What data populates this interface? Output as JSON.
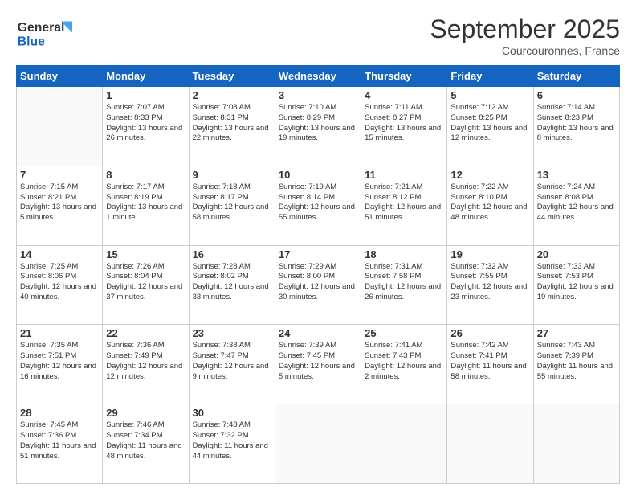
{
  "header": {
    "logo_line1": "General",
    "logo_line2": "Blue",
    "month": "September 2025",
    "location": "Courcouronnes, France"
  },
  "weekdays": [
    "Sunday",
    "Monday",
    "Tuesday",
    "Wednesday",
    "Thursday",
    "Friday",
    "Saturday"
  ],
  "weeks": [
    [
      {
        "day": "",
        "info": ""
      },
      {
        "day": "1",
        "info": "Sunrise: 7:07 AM\nSunset: 8:33 PM\nDaylight: 13 hours\nand 26 minutes."
      },
      {
        "day": "2",
        "info": "Sunrise: 7:08 AM\nSunset: 8:31 PM\nDaylight: 13 hours\nand 22 minutes."
      },
      {
        "day": "3",
        "info": "Sunrise: 7:10 AM\nSunset: 8:29 PM\nDaylight: 13 hours\nand 19 minutes."
      },
      {
        "day": "4",
        "info": "Sunrise: 7:11 AM\nSunset: 8:27 PM\nDaylight: 13 hours\nand 15 minutes."
      },
      {
        "day": "5",
        "info": "Sunrise: 7:12 AM\nSunset: 8:25 PM\nDaylight: 13 hours\nand 12 minutes."
      },
      {
        "day": "6",
        "info": "Sunrise: 7:14 AM\nSunset: 8:23 PM\nDaylight: 13 hours\nand 8 minutes."
      }
    ],
    [
      {
        "day": "7",
        "info": "Sunrise: 7:15 AM\nSunset: 8:21 PM\nDaylight: 13 hours\nand 5 minutes."
      },
      {
        "day": "8",
        "info": "Sunrise: 7:17 AM\nSunset: 8:19 PM\nDaylight: 13 hours\nand 1 minute."
      },
      {
        "day": "9",
        "info": "Sunrise: 7:18 AM\nSunset: 8:17 PM\nDaylight: 12 hours\nand 58 minutes."
      },
      {
        "day": "10",
        "info": "Sunrise: 7:19 AM\nSunset: 8:14 PM\nDaylight: 12 hours\nand 55 minutes."
      },
      {
        "day": "11",
        "info": "Sunrise: 7:21 AM\nSunset: 8:12 PM\nDaylight: 12 hours\nand 51 minutes."
      },
      {
        "day": "12",
        "info": "Sunrise: 7:22 AM\nSunset: 8:10 PM\nDaylight: 12 hours\nand 48 minutes."
      },
      {
        "day": "13",
        "info": "Sunrise: 7:24 AM\nSunset: 8:08 PM\nDaylight: 12 hours\nand 44 minutes."
      }
    ],
    [
      {
        "day": "14",
        "info": "Sunrise: 7:25 AM\nSunset: 8:06 PM\nDaylight: 12 hours\nand 40 minutes."
      },
      {
        "day": "15",
        "info": "Sunrise: 7:26 AM\nSunset: 8:04 PM\nDaylight: 12 hours\nand 37 minutes."
      },
      {
        "day": "16",
        "info": "Sunrise: 7:28 AM\nSunset: 8:02 PM\nDaylight: 12 hours\nand 33 minutes."
      },
      {
        "day": "17",
        "info": "Sunrise: 7:29 AM\nSunset: 8:00 PM\nDaylight: 12 hours\nand 30 minutes."
      },
      {
        "day": "18",
        "info": "Sunrise: 7:31 AM\nSunset: 7:58 PM\nDaylight: 12 hours\nand 26 minutes."
      },
      {
        "day": "19",
        "info": "Sunrise: 7:32 AM\nSunset: 7:55 PM\nDaylight: 12 hours\nand 23 minutes."
      },
      {
        "day": "20",
        "info": "Sunrise: 7:33 AM\nSunset: 7:53 PM\nDaylight: 12 hours\nand 19 minutes."
      }
    ],
    [
      {
        "day": "21",
        "info": "Sunrise: 7:35 AM\nSunset: 7:51 PM\nDaylight: 12 hours\nand 16 minutes."
      },
      {
        "day": "22",
        "info": "Sunrise: 7:36 AM\nSunset: 7:49 PM\nDaylight: 12 hours\nand 12 minutes."
      },
      {
        "day": "23",
        "info": "Sunrise: 7:38 AM\nSunset: 7:47 PM\nDaylight: 12 hours\nand 9 minutes."
      },
      {
        "day": "24",
        "info": "Sunrise: 7:39 AM\nSunset: 7:45 PM\nDaylight: 12 hours\nand 5 minutes."
      },
      {
        "day": "25",
        "info": "Sunrise: 7:41 AM\nSunset: 7:43 PM\nDaylight: 12 hours\nand 2 minutes."
      },
      {
        "day": "26",
        "info": "Sunrise: 7:42 AM\nSunset: 7:41 PM\nDaylight: 11 hours\nand 58 minutes."
      },
      {
        "day": "27",
        "info": "Sunrise: 7:43 AM\nSunset: 7:39 PM\nDaylight: 11 hours\nand 55 minutes."
      }
    ],
    [
      {
        "day": "28",
        "info": "Sunrise: 7:45 AM\nSunset: 7:36 PM\nDaylight: 11 hours\nand 51 minutes."
      },
      {
        "day": "29",
        "info": "Sunrise: 7:46 AM\nSunset: 7:34 PM\nDaylight: 11 hours\nand 48 minutes."
      },
      {
        "day": "30",
        "info": "Sunrise: 7:48 AM\nSunset: 7:32 PM\nDaylight: 11 hours\nand 44 minutes."
      },
      {
        "day": "",
        "info": ""
      },
      {
        "day": "",
        "info": ""
      },
      {
        "day": "",
        "info": ""
      },
      {
        "day": "",
        "info": ""
      }
    ]
  ]
}
